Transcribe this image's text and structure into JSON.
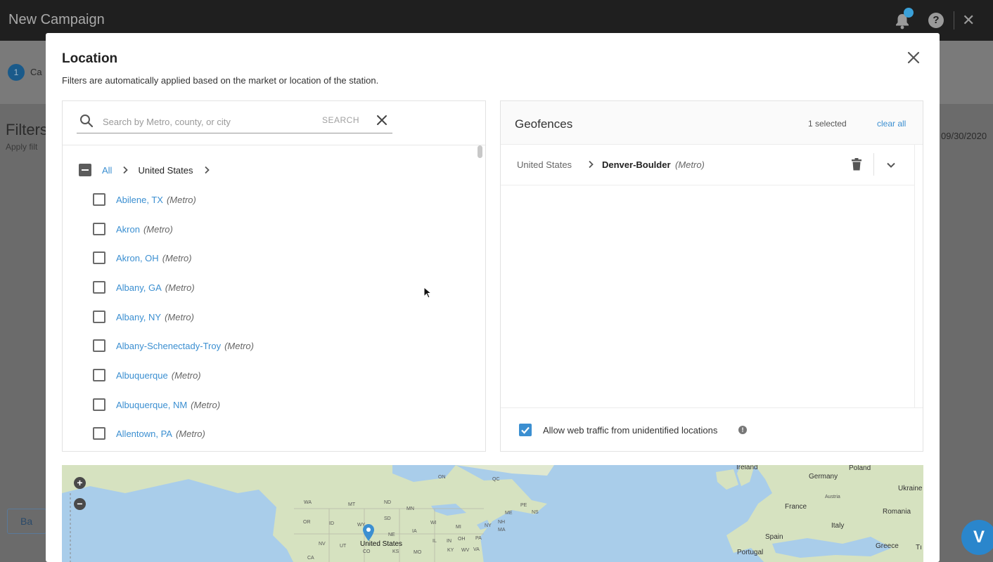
{
  "app": {
    "title": "New Campaign",
    "step_number": "1",
    "step_label": "Ca",
    "filters_title": "Filters",
    "filters_sub": "Apply filt",
    "date_text": "09/30/2020",
    "back_label": "Ba",
    "chat_logo": "V"
  },
  "modal": {
    "title": "Location",
    "subtitle": "Filters are automatically applied based on the market or location of the station."
  },
  "search": {
    "placeholder": "Search by Metro, county, or city",
    "button_label": "SEARCH"
  },
  "breadcrumb": {
    "all_label": "All",
    "country_label": "United States"
  },
  "locations": [
    {
      "name": "Abilene, TX",
      "type": "(Metro)"
    },
    {
      "name": "Akron",
      "type": "(Metro)"
    },
    {
      "name": "Akron, OH",
      "type": "(Metro)"
    },
    {
      "name": "Albany, GA",
      "type": "(Metro)"
    },
    {
      "name": "Albany, NY",
      "type": "(Metro)"
    },
    {
      "name": "Albany-Schenectady-Troy",
      "type": "(Metro)"
    },
    {
      "name": "Albuquerque",
      "type": "(Metro)"
    },
    {
      "name": "Albuquerque, NM",
      "type": "(Metro)"
    },
    {
      "name": "Allentown, PA",
      "type": "(Metro)"
    }
  ],
  "geofences": {
    "title": "Geofences",
    "selected_count": "1 selected",
    "clear_all_label": "clear all",
    "items": [
      {
        "country": "United States",
        "name": "Denver-Boulder",
        "type": "(Metro)"
      }
    ],
    "allow_label": "Allow web traffic from unidentified locations",
    "allow_checked": true,
    "info_glyph": "!"
  },
  "map": {
    "zoom_in_label": "+",
    "zoom_out_label": "−",
    "labels": {
      "ireland": "Ireland",
      "poland": "Poland",
      "germany": "Germany",
      "austria": "Austria",
      "ukraine": "Ukraine",
      "france": "France",
      "romania": "Romania",
      "italy": "Italy",
      "spain": "Spain",
      "greece": "Greece",
      "portugal": "Portugal",
      "turkey": "Tı",
      "united_states": "United States",
      "on": "ON",
      "qc": "QC",
      "wa": "WA",
      "mt": "MT",
      "nd": "ND",
      "mn": "MN",
      "or": "OR",
      "id": "ID",
      "wy": "WY",
      "sd": "SD",
      "ia": "IA",
      "ne": "NE",
      "nv": "NV",
      "ut": "UT",
      "co": "CO",
      "ks": "KS",
      "mo": "MO",
      "ca": "CA",
      "wi": "WI",
      "mi": "MI",
      "il": "IL",
      "in": "IN",
      "oh": "OH",
      "pa": "PA",
      "ny": "NY",
      "nh": "NH",
      "ma": "MA",
      "me": "ME",
      "pe": "PE",
      "ns": "NS",
      "ky": "KY",
      "wv": "WV",
      "va": "VA"
    }
  },
  "colors": {
    "accent": "#3b8fd1",
    "topbar": "#1f1f1f",
    "overlay": "#6b6b6b",
    "water": "#a9cdea",
    "land": "#d6e2c0"
  }
}
